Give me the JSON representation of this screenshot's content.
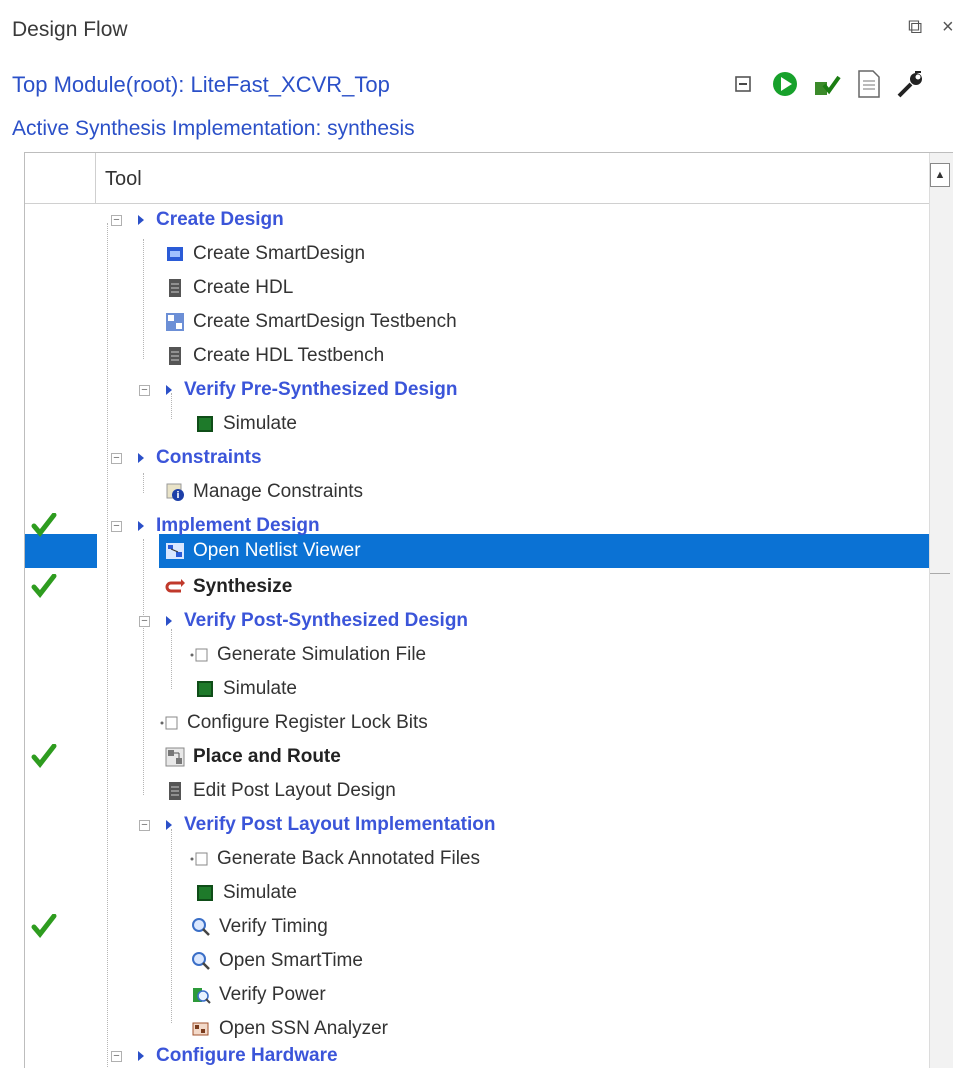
{
  "panel": {
    "title": "Design Flow",
    "restore_glyph": "⧉",
    "close_glyph": "×"
  },
  "top_module": "Top Module(root): LiteFast_XCVR_Top",
  "active_synthesis": "Active Synthesis Implementation: synthesis",
  "toolbar": {
    "buttons": [
      "collapse-all-icon",
      "run-icon",
      "clean-run-icon",
      "report-icon",
      "tool-options-icon"
    ]
  },
  "tree": {
    "column_header": "Tool",
    "rows": [
      {
        "label": "Create Design",
        "type": "group",
        "checked": false
      },
      {
        "label": "Create SmartDesign",
        "type": "item",
        "checked": false
      },
      {
        "label": "Create HDL",
        "type": "item",
        "checked": false
      },
      {
        "label": "Create SmartDesign Testbench",
        "type": "item",
        "checked": false
      },
      {
        "label": "Create HDL Testbench",
        "type": "item",
        "checked": false
      },
      {
        "label": "Verify Pre-Synthesized Design",
        "type": "group",
        "checked": false
      },
      {
        "label": "Simulate",
        "type": "item",
        "checked": false
      },
      {
        "label": "Constraints",
        "type": "group",
        "checked": false
      },
      {
        "label": "Manage Constraints",
        "type": "item",
        "checked": false
      },
      {
        "label": "Implement Design",
        "type": "group",
        "checked": true
      },
      {
        "label": "Open Netlist Viewer",
        "type": "item",
        "checked": false,
        "selected": true
      },
      {
        "label": "Synthesize",
        "type": "item-bold",
        "checked": true
      },
      {
        "label": "Verify Post-Synthesized Design",
        "type": "group",
        "checked": false
      },
      {
        "label": "Generate Simulation File",
        "type": "item",
        "checked": false
      },
      {
        "label": "Simulate",
        "type": "item",
        "checked": false
      },
      {
        "label": "Configure Register Lock Bits",
        "type": "item",
        "checked": false
      },
      {
        "label": "Place and Route",
        "type": "item-bold",
        "checked": true
      },
      {
        "label": "Edit Post Layout Design",
        "type": "item",
        "checked": false
      },
      {
        "label": "Verify Post Layout Implementation",
        "type": "group",
        "checked": false
      },
      {
        "label": "Generate Back Annotated Files",
        "type": "item",
        "checked": false
      },
      {
        "label": "Simulate",
        "type": "item",
        "checked": false
      },
      {
        "label": "Verify Timing",
        "type": "item",
        "checked": true
      },
      {
        "label": "Open SmartTime",
        "type": "item",
        "checked": false
      },
      {
        "label": "Verify Power",
        "type": "item",
        "checked": false
      },
      {
        "label": "Open SSN Analyzer",
        "type": "item",
        "checked": false
      },
      {
        "label": "Configure Hardware",
        "type": "group",
        "checked": false
      }
    ]
  },
  "colors": {
    "link_blue": "#2b50c8",
    "group_blue": "#3b55d9",
    "selection": "#0b72d4",
    "check_green": "#2e9c1f"
  }
}
